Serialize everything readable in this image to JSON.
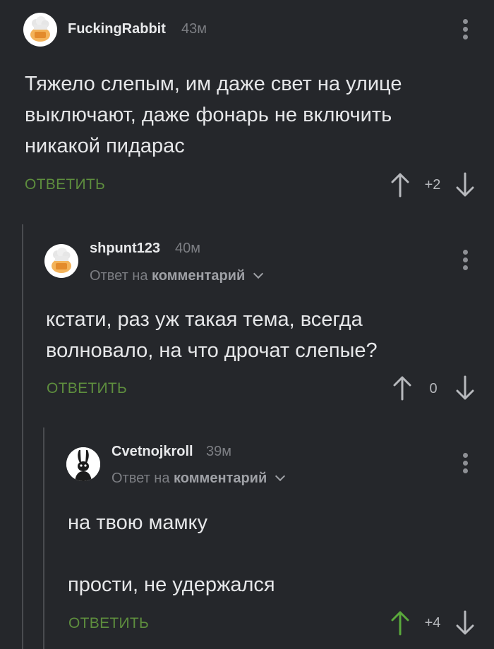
{
  "colors": {
    "background": "#25272b",
    "accent_green": "#5e8e3e",
    "upvoted_green": "#5aa93c",
    "muted": "#7c7e83",
    "thread_line": "#4a4c50"
  },
  "comments": [
    {
      "username": "FuckingRabbit",
      "time": "43м",
      "avatar_icon": "chef-hat-orange-avatar",
      "lines": [
        "Тяжело слепым, им даже свет на улице",
        "выключают, даже фонарь не включить",
        "никакой пидарас"
      ],
      "reply_label": "ОТВЕТИТЬ",
      "score": "+2",
      "upvoted": false
    },
    {
      "username": "shpunt123",
      "time": "40м",
      "avatar_icon": "chef-hat-orange-avatar",
      "reply_to_prefix": "Ответ на",
      "reply_to_target": "комментарий",
      "lines": [
        "кстати, раз уж такая тема, всегда",
        "волновало, на что дрочат слепые?"
      ],
      "reply_label": "ОТВЕТИТЬ",
      "score": "0",
      "upvoted": false
    },
    {
      "username": "Cvetnojkroll",
      "time": "39м",
      "avatar_icon": "rabbit-character-avatar",
      "reply_to_prefix": "Ответ на",
      "reply_to_target": "комментарий",
      "lines": [
        "на твою мамку",
        "",
        "прости, не удержался"
      ],
      "reply_label": "ОТВЕТИТЬ",
      "score": "+4",
      "upvoted": true
    }
  ]
}
